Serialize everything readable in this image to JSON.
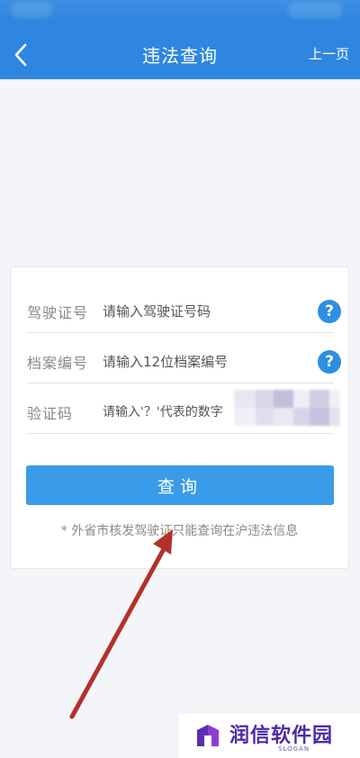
{
  "header": {
    "title": "违法查询",
    "prev_page_label": "上一页"
  },
  "form": {
    "rows": [
      {
        "label": "驾驶证号",
        "placeholder": "请输入驾驶证号码",
        "help_icon": "question-circle-icon"
      },
      {
        "label": "档案编号",
        "placeholder": "请输入12位档案编号",
        "help_icon": "question-circle-icon"
      },
      {
        "label": "验证码",
        "placeholder": "请输入'？'代表的数字"
      }
    ],
    "query_button_label": "查询",
    "note": "* 外省市核发驾驶证只能查询在沪违法信息"
  },
  "watermark": {
    "text": "润信软件园",
    "slogan": "SLOGAN"
  },
  "colors": {
    "header_bg": "#2f86e0",
    "button_bg": "#3a9be8",
    "help_icon_bg": "#2f8ee0",
    "annotation_arrow": "#b3312a",
    "watermark_text": "#4b2aa6"
  }
}
